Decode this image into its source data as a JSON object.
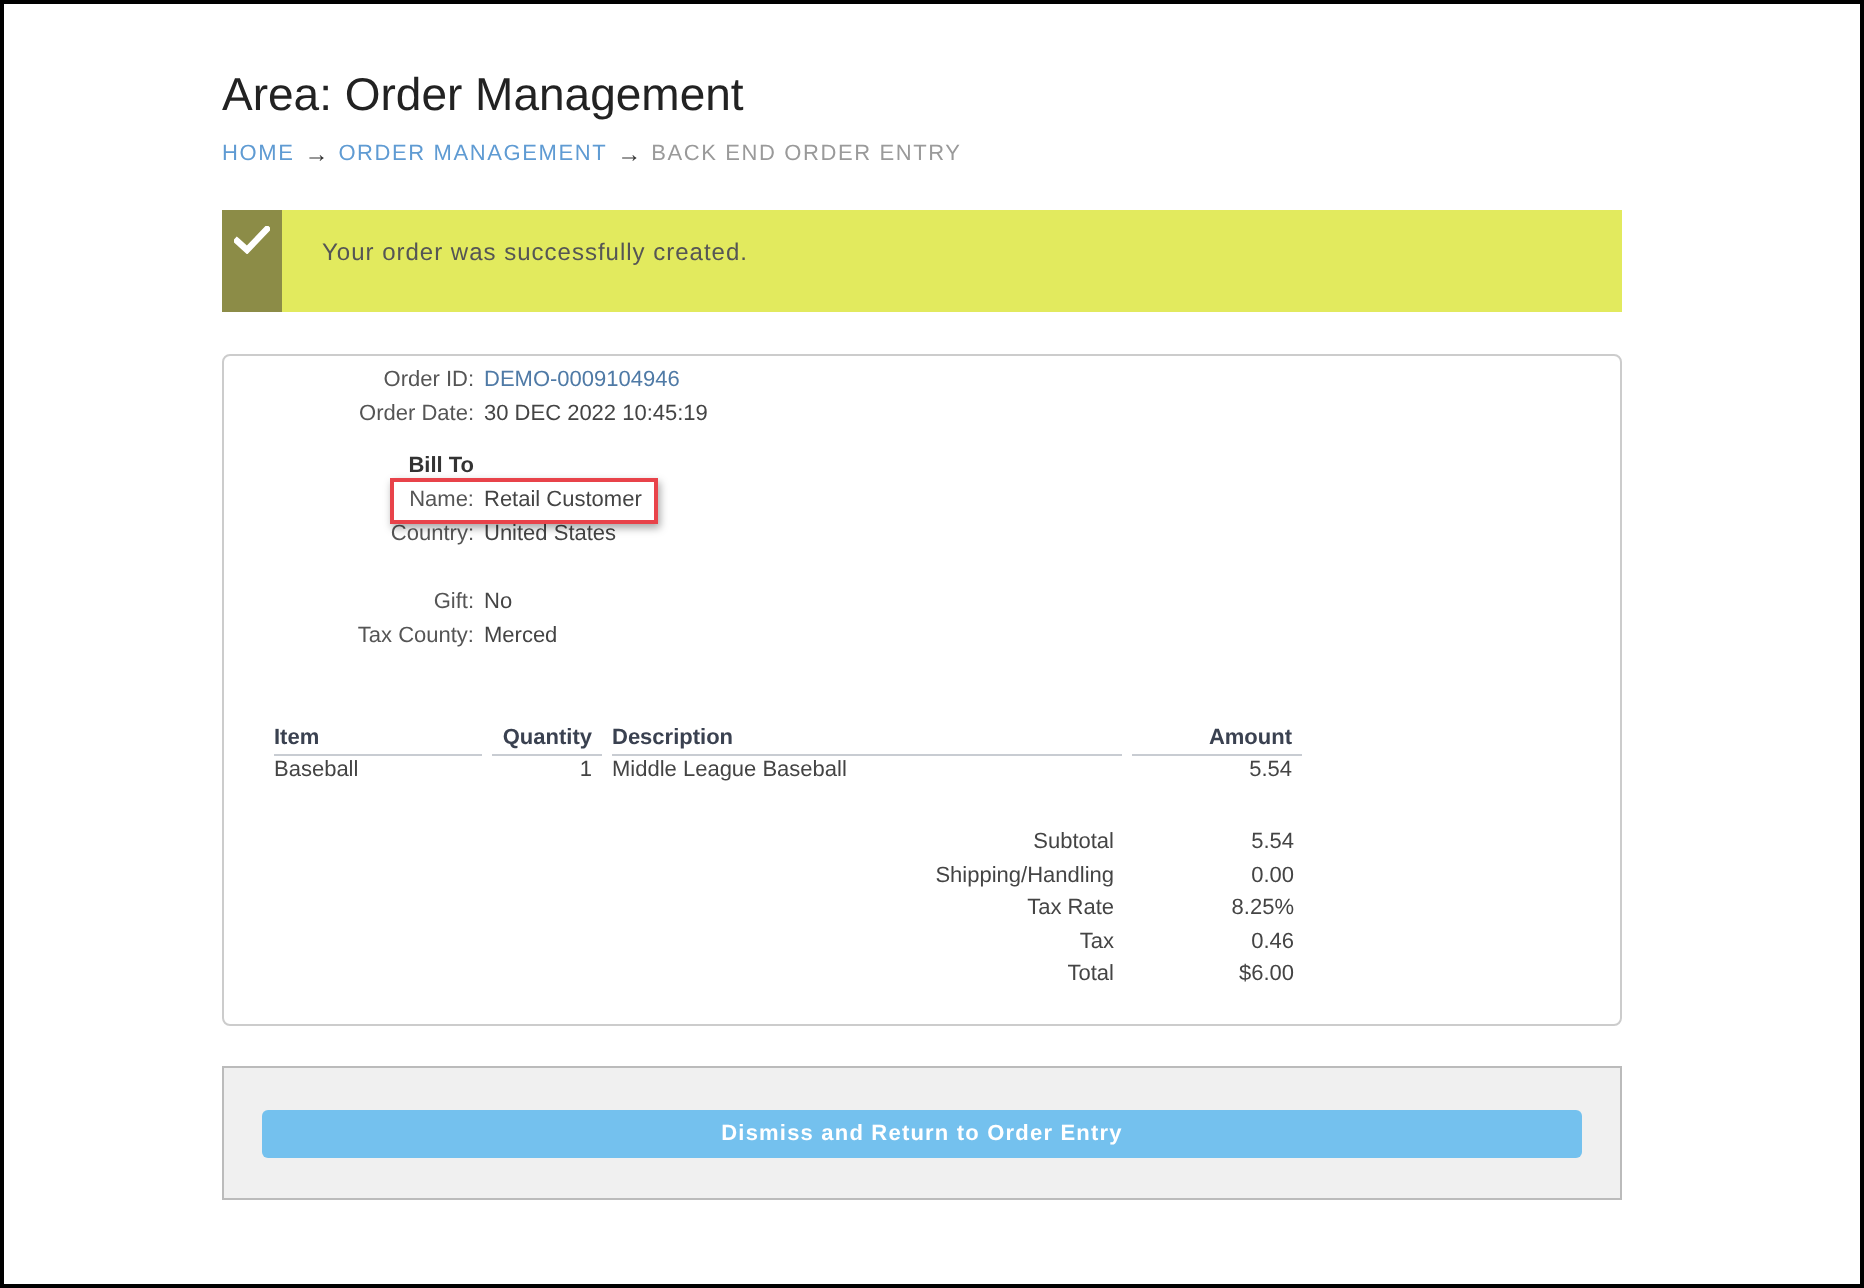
{
  "page": {
    "title": "Area: Order Management"
  },
  "breadcrumb": [
    {
      "kind": "link",
      "label": "HOME"
    },
    {
      "kind": "separator",
      "label": "→"
    },
    {
      "kind": "link",
      "label": "ORDER MANAGEMENT"
    },
    {
      "kind": "separator",
      "label": "→"
    },
    {
      "kind": "current",
      "label": "BACK END ORDER ENTRY"
    }
  ],
  "alert": {
    "kind": "success",
    "message": "Your order was successfully created."
  },
  "order": {
    "sections": [
      {
        "fields": [
          {
            "label": "Order ID:",
            "value": "DEMO-0009104946",
            "kind": "link",
            "highlighted": false
          },
          {
            "label": "Order Date:",
            "value": "30 DEC 2022 10:45:19",
            "kind": "text",
            "highlighted": false
          }
        ]
      },
      {
        "heading": "Bill To",
        "fields": [
          {
            "label": "Name:",
            "value": "Retail Customer",
            "kind": "text",
            "highlighted": true
          },
          {
            "label": "Country:",
            "value": "United States",
            "kind": "text",
            "highlighted": false
          }
        ]
      },
      {
        "fields": [
          {
            "label": "Gift:",
            "value": "No",
            "kind": "text",
            "highlighted": false
          },
          {
            "label": "Tax County:",
            "value": "Merced",
            "kind": "text",
            "highlighted": false
          }
        ]
      }
    ]
  },
  "table": {
    "columns": [
      {
        "label": "Item",
        "kind": "text"
      },
      {
        "label": "Quantity",
        "kind": "number"
      },
      {
        "label": "Description",
        "kind": "text"
      },
      {
        "label": "Amount",
        "kind": "number"
      }
    ],
    "rows": [
      [
        "Baseball",
        "1",
        "Middle League Baseball",
        "5.54"
      ]
    ]
  },
  "totals": [
    {
      "label": "Subtotal",
      "value": "5.54"
    },
    {
      "label": "Shipping/Handling",
      "value": "0.00"
    },
    {
      "label": "Tax Rate",
      "value": "8.25%"
    },
    {
      "label": "Tax",
      "value": "0.46"
    },
    {
      "label": "Total",
      "value": "$6.00"
    }
  ],
  "footer": {
    "button": "Dismiss and Return to Order Entry"
  }
}
